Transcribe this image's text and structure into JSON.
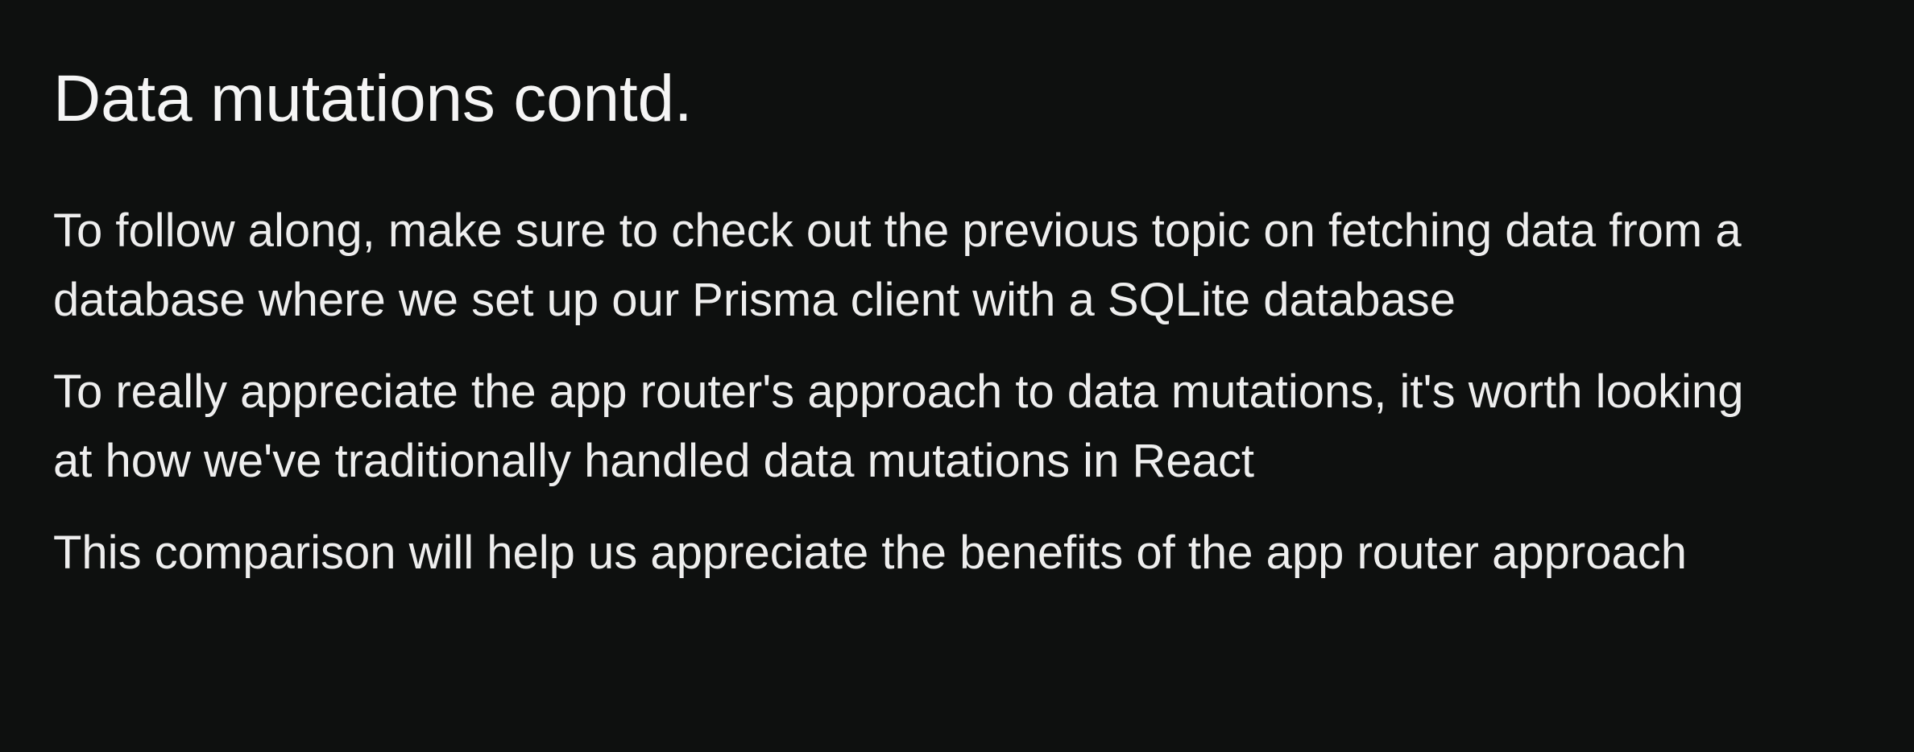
{
  "slide": {
    "title": "Data mutations contd.",
    "paragraphs": [
      {
        "line1": "To follow along, make sure to check out the previous topic on fetching data from a",
        "line2": "database where we set up our Prisma client with a SQLite database"
      },
      {
        "line1": "To really appreciate the app router's approach to data mutations, it's worth looking",
        "line2": "at how we've traditionally handled data mutations in React"
      },
      {
        "line1": "This comparison will help us appreciate the benefits of the app router approach"
      }
    ]
  },
  "colors": {
    "background": "#0e100f",
    "text": "#eeeeee"
  }
}
